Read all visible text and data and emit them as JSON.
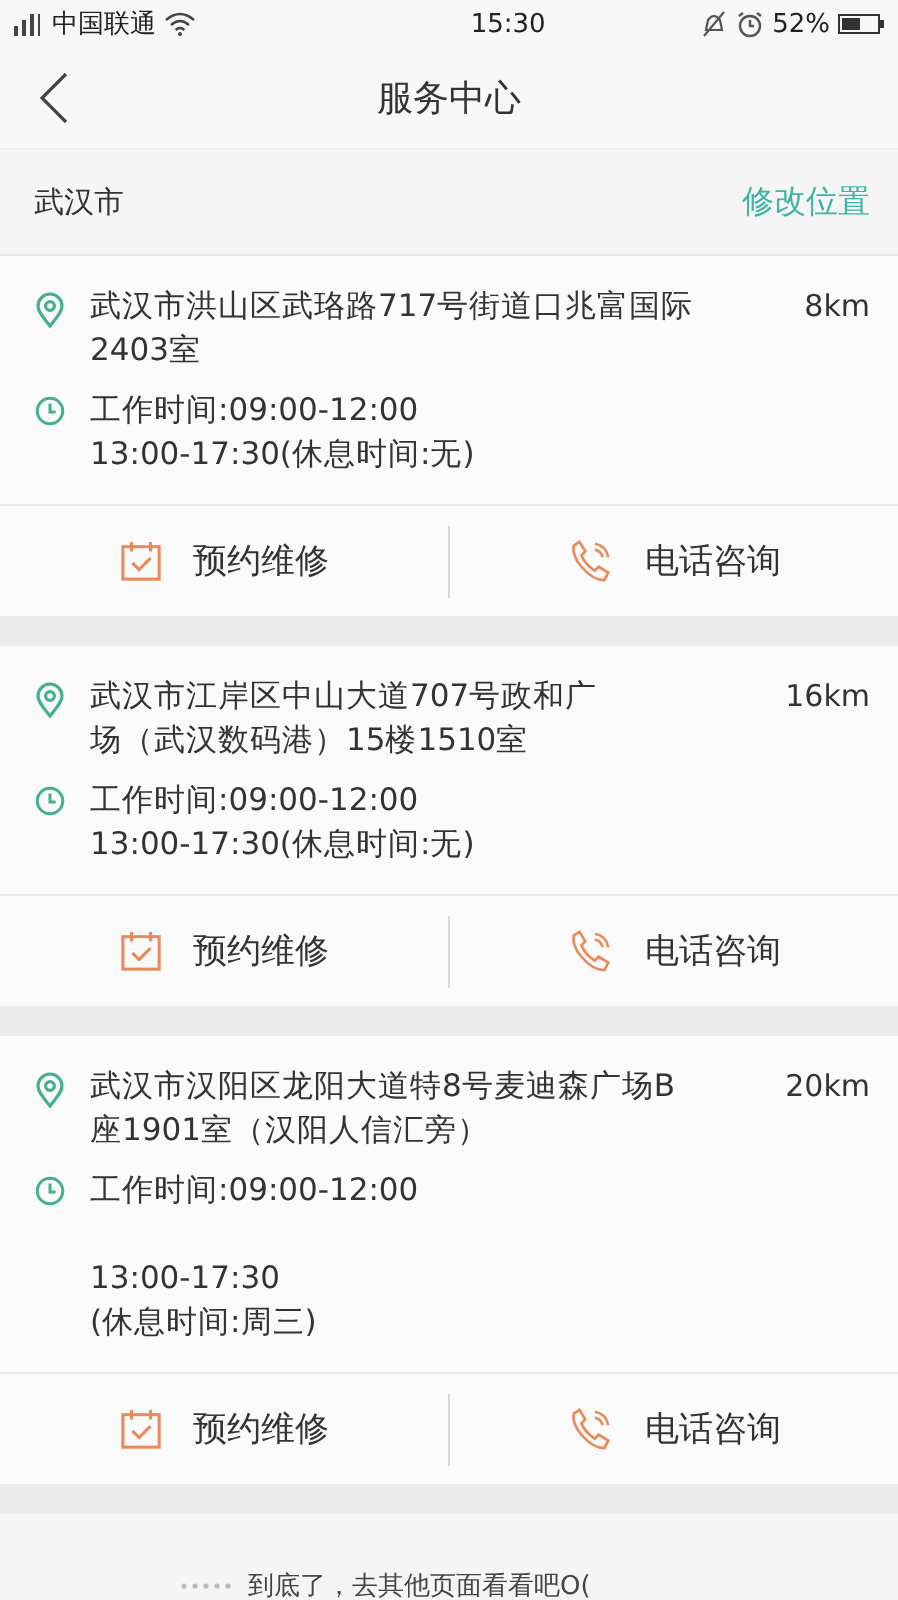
{
  "status_bar": {
    "carrier": "中国联通",
    "time": "15:30",
    "battery": "52%"
  },
  "nav": {
    "title": "服务中心"
  },
  "location": {
    "city": "武汉市",
    "action": "修改位置"
  },
  "centers": [
    {
      "address_lines": [
        "武汉市洪山区武珞路717号街道口兆富国际",
        "2403室"
      ],
      "distance": "8km",
      "hours": [
        [
          "工作时间:09:00-12:00",
          "13:00-17:30(休息时间:无)"
        ]
      ],
      "actions": [
        {
          "kind": "booking",
          "label": "预约维修"
        },
        {
          "kind": "phone",
          "label": "电话咨询"
        }
      ]
    },
    {
      "address_lines": [
        "武汉市江岸区中山大道707号政和广",
        "场（武汉数码港）15楼1510室"
      ],
      "distance": "16km",
      "hours": [
        [
          "工作时间:09:00-12:00",
          "13:00-17:30(休息时间:无)"
        ]
      ],
      "actions": [
        {
          "kind": "booking",
          "label": "预约维修"
        },
        {
          "kind": "phone",
          "label": "电话咨询"
        }
      ]
    },
    {
      "address_lines": [
        "武汉市汉阳区龙阳大道特8号麦迪森广场B",
        "座1901室（汉阳人信汇旁）"
      ],
      "distance": "20km",
      "hours": [
        [
          "工作时间:09:00-12:00"
        ],
        [
          "13:00-17:30",
          "(休息时间:周三)"
        ]
      ],
      "actions": [
        {
          "kind": "booking",
          "label": "预约维修"
        },
        {
          "kind": "phone",
          "label": "电话咨询"
        }
      ]
    }
  ],
  "footer": {
    "text": "到底了，去其他页面看看吧O("
  }
}
